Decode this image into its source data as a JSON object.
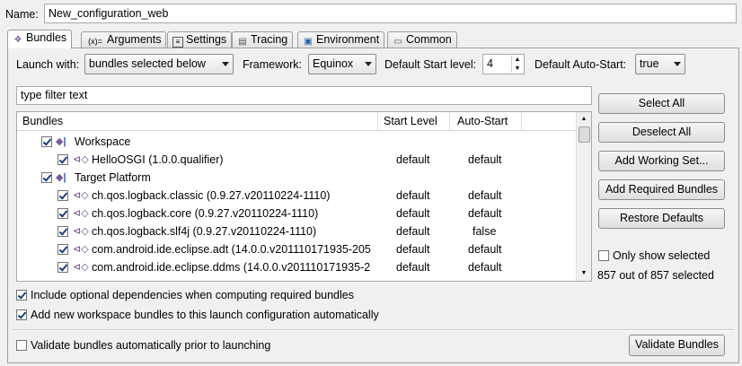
{
  "name": {
    "label": "Name:",
    "value": "New_configuration_web"
  },
  "tabs": [
    {
      "label": "Bundles",
      "icon": "bundles-icon",
      "active": true
    },
    {
      "label": "Arguments",
      "icon": "arguments-icon",
      "glyph": "(x)="
    },
    {
      "label": "Settings",
      "icon": "settings-icon"
    },
    {
      "label": "Tracing",
      "icon": "tracing-icon"
    },
    {
      "label": "Environment",
      "icon": "environment-icon"
    },
    {
      "label": "Common",
      "icon": "common-icon"
    }
  ],
  "launch": {
    "launch_with_label": "Launch with:",
    "launch_with_value": "bundles selected below",
    "framework_label": "Framework:",
    "framework_value": "Equinox",
    "start_level_label": "Default Start level:",
    "start_level_value": "4",
    "auto_start_label": "Default Auto-Start:",
    "auto_start_value": "true"
  },
  "filter": {
    "placeholder": "type filter text",
    "value": "type filter text"
  },
  "table": {
    "headers": [
      "Bundles",
      "Start Level",
      "Auto-Start"
    ],
    "rows": [
      {
        "indent": 0,
        "checked": true,
        "icon": "workspace-icon",
        "name": "Workspace",
        "start": "",
        "auto": ""
      },
      {
        "indent": 1,
        "checked": true,
        "icon": "plugin-icon",
        "name": "HelloOSGI (1.0.0.qualifier)",
        "start": "default",
        "auto": "default"
      },
      {
        "indent": 0,
        "checked": true,
        "icon": "target-platform-icon",
        "name": "Target Platform",
        "start": "",
        "auto": ""
      },
      {
        "indent": 1,
        "checked": true,
        "icon": "jar-bundle-icon",
        "name": "ch.qos.logback.classic (0.9.27.v20110224-1110)",
        "start": "default",
        "auto": "default"
      },
      {
        "indent": 1,
        "checked": true,
        "icon": "jar-bundle-icon",
        "name": "ch.qos.logback.core (0.9.27.v20110224-1110)",
        "start": "default",
        "auto": "default"
      },
      {
        "indent": 1,
        "checked": true,
        "icon": "jar-bundle-icon",
        "name": "ch.qos.logback.slf4j (0.9.27.v20110224-1110)",
        "start": "default",
        "auto": "false"
      },
      {
        "indent": 1,
        "checked": true,
        "icon": "jar-bundle-icon",
        "name": "com.android.ide.eclipse.adt (14.0.0.v201110171935-205",
        "start": "default",
        "auto": "default"
      },
      {
        "indent": 1,
        "checked": true,
        "icon": "jar-bundle-icon",
        "name": "com.android.ide.eclipse.ddms (14.0.0.v201110171935-2",
        "start": "default",
        "auto": "default"
      }
    ]
  },
  "buttons": {
    "select_all": "Select All",
    "deselect_all": "Deselect All",
    "add_working_set": "Add Working Set...",
    "add_required": "Add Required Bundles",
    "restore_defaults": "Restore Defaults",
    "validate_bundles": "Validate Bundles"
  },
  "only_show_selected": {
    "label": "Only show selected",
    "checked": false
  },
  "selection_count": "857 out of 857 selected",
  "options": {
    "include_optional": {
      "label": "Include optional dependencies when computing required bundles",
      "checked": true
    },
    "add_new_workspace": {
      "label": "Add new workspace bundles to this launch configuration automatically",
      "checked": true
    },
    "validate_auto": {
      "label": "Validate bundles automatically prior to launching",
      "checked": false
    }
  },
  "colors": {
    "accent": "#1b3e7a",
    "border": "#a9a9a9",
    "background": "#f0f0f0"
  }
}
